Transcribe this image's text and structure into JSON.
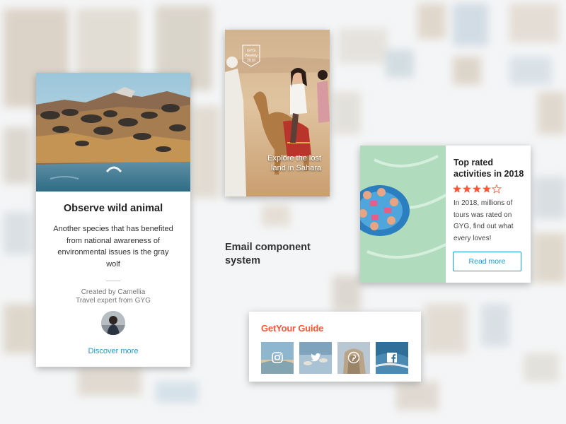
{
  "wild_card": {
    "title": "Observe wild animal",
    "description": "Another species that has benefited from national awareness of environmental issues is the gray wolf",
    "created_by": "Created by Camellia",
    "role": "Travel expert from GYG",
    "link": "Discover more"
  },
  "camel_card": {
    "badge_line1": "GYG",
    "badge_line2": "Weekly",
    "badge_line3": "2018",
    "caption_line1": "Explore the lost",
    "caption_line2": "land in Sahara"
  },
  "system_title": "Email component system",
  "rated_card": {
    "title": "Top rated activities in 2018",
    "rating": 4.5,
    "rating_max": 5,
    "text": "In 2018, millions of tours was rated on GYG, find out what every loves!",
    "button": "Read more"
  },
  "social_card": {
    "logo": "GetYour Guide",
    "icons": [
      "instagram-icon",
      "twitter-icon",
      "pinterest-icon",
      "facebook-icon"
    ]
  },
  "colors": {
    "accent": "#1a9bd7",
    "brand": "#ff5533",
    "star": "#ff5533"
  }
}
